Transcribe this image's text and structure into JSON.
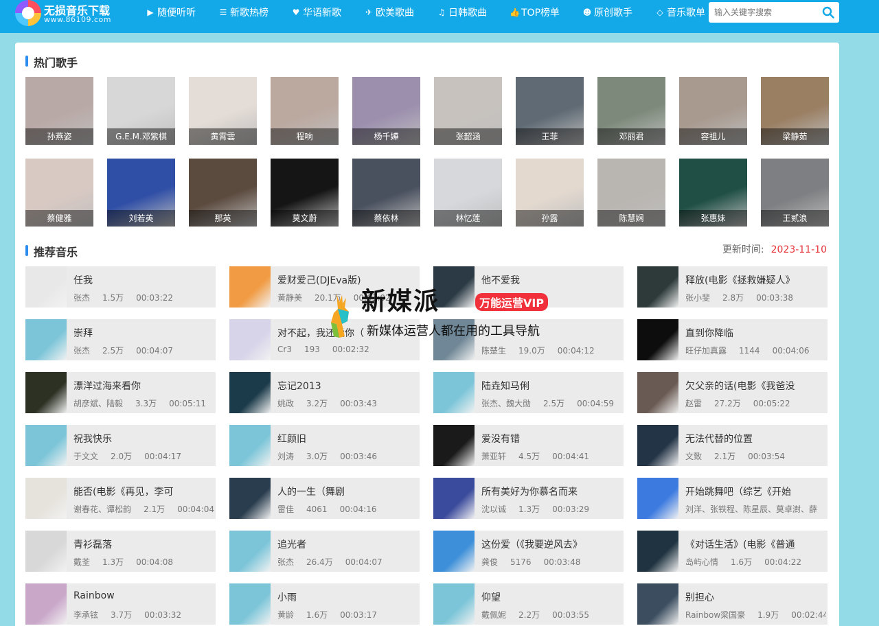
{
  "header": {
    "logo_title": "无损音乐下载",
    "logo_url": "www.86109.com",
    "nav": [
      {
        "icon": "play-circle-icon",
        "label": "随便听听"
      },
      {
        "icon": "list-icon",
        "label": "新歌热榜"
      },
      {
        "icon": "heart-icon",
        "label": "华语新歌"
      },
      {
        "icon": "plane-icon",
        "label": "欧美歌曲"
      },
      {
        "icon": "music-note-icon",
        "label": "日韩歌曲"
      },
      {
        "icon": "thumbs-up-icon",
        "label": "TOP榜单"
      },
      {
        "icon": "user-circle-icon",
        "label": "原创歌手"
      },
      {
        "icon": "diamond-icon",
        "label": "音乐歌单"
      }
    ],
    "search_placeholder": "输入关键字搜索"
  },
  "hot_singers": {
    "title": "热门歌手",
    "singers": [
      {
        "name": "孙燕姿",
        "color": "#b9a9a6"
      },
      {
        "name": "G.E.M.邓紫棋",
        "color": "#d7d7d7"
      },
      {
        "name": "黄霄雲",
        "color": "#e4dcd6"
      },
      {
        "name": "程响",
        "color": "#bba9a0"
      },
      {
        "name": "杨千嬅",
        "color": "#9c8fae"
      },
      {
        "name": "张韶涵",
        "color": "#c7c2bd"
      },
      {
        "name": "王菲",
        "color": "#5f6a74"
      },
      {
        "name": "邓丽君",
        "color": "#7d8a7b"
      },
      {
        "name": "容祖儿",
        "color": "#a89a8f"
      },
      {
        "name": "梁静茹",
        "color": "#9a7f63"
      },
      {
        "name": "蔡健雅",
        "color": "#d9c9c3"
      },
      {
        "name": "刘若英",
        "color": "#2f4ea6"
      },
      {
        "name": "那英",
        "color": "#5b4a3e"
      },
      {
        "name": "莫文蔚",
        "color": "#151515"
      },
      {
        "name": "蔡依林",
        "color": "#49505e"
      },
      {
        "name": "林忆莲",
        "color": "#d6d8dc"
      },
      {
        "name": "孙露",
        "color": "#e3d9cf"
      },
      {
        "name": "陈慧娴",
        "color": "#b9b5b0"
      },
      {
        "name": "张惠妹",
        "color": "#1f4f45"
      },
      {
        "name": "王贰浪",
        "color": "#7e7f82"
      }
    ]
  },
  "recommended": {
    "title": "推荐音乐",
    "update_label": "更新时间:",
    "update_date": "2023-11-10",
    "songs": [
      {
        "title": "任我",
        "artist": "张杰",
        "plays": "1.5万",
        "duration": "00:03:22",
        "cover": "#e8e8e8"
      },
      {
        "title": "爱财爱己(DJEva版)",
        "artist": "黄静美",
        "plays": "20.1万",
        "duration": "00:03:02",
        "cover": "#f19c45"
      },
      {
        "title": "他不爱我",
        "artist": "",
        "plays": "",
        "duration": "",
        "cover": "#2b3a44"
      },
      {
        "title": "释放(电影《拯救嫌疑人》",
        "artist": "张小斐",
        "plays": "2.8万",
        "duration": "00:03:38",
        "cover": "#2e3a3a"
      },
      {
        "title": "崇拜",
        "artist": "张杰",
        "plays": "2.5万",
        "duration": "00:04:07",
        "cover": "#7cc5d8"
      },
      {
        "title": "对不起，我还爱你（",
        "artist": "Cr3",
        "plays": "193",
        "duration": "00:02:32",
        "cover": "#d7d3e9"
      },
      {
        "title": "",
        "artist": "陈楚生",
        "plays": "19.0万",
        "duration": "00:04:12",
        "cover": "#6f8796"
      },
      {
        "title": "直到你降临",
        "artist": "旺仔加真露",
        "plays": "1144",
        "duration": "00:04:06",
        "cover": "#0d0d0d"
      },
      {
        "title": "漂洋过海来看你",
        "artist": "胡彦斌、陆毅",
        "plays": "3.3万",
        "duration": "00:05:11",
        "cover": "#2c3124"
      },
      {
        "title": "忘记2013",
        "artist": "姚政",
        "plays": "3.2万",
        "duration": "00:03:43",
        "cover": "#1c3b4a"
      },
      {
        "title": "陆垚知马俐",
        "artist": "张杰、魏大勋",
        "plays": "2.5万",
        "duration": "00:04:59",
        "cover": "#7cc5d8"
      },
      {
        "title": "欠父亲的话(电影《我爸没",
        "artist": "赵雷",
        "plays": "27.2万",
        "duration": "00:05:22",
        "cover": "#6a5a54"
      },
      {
        "title": "祝我快乐",
        "artist": "于文文",
        "plays": "2.0万",
        "duration": "00:04:17",
        "cover": "#7cc5d8"
      },
      {
        "title": "红颜旧",
        "artist": "刘涛",
        "plays": "3.0万",
        "duration": "00:03:46",
        "cover": "#7cc5d8"
      },
      {
        "title": "爱没有错",
        "artist": "萧亚轩",
        "plays": "4.5万",
        "duration": "00:04:41",
        "cover": "#1a1a1a"
      },
      {
        "title": "无法代替的位置",
        "artist": "文致",
        "plays": "2.1万",
        "duration": "00:03:54",
        "cover": "#243447"
      },
      {
        "title": "能否(电影《再见，李可",
        "artist": "谢春花、谭松韵",
        "plays": "2.1万",
        "duration": "00:04:04",
        "cover": "#e6e2dc"
      },
      {
        "title": "人的一生（舞剧",
        "artist": "雷佳",
        "plays": "4061",
        "duration": "00:04:16",
        "cover": "#2a3d4f"
      },
      {
        "title": "所有美好为你慕名而来",
        "artist": "沈以诚",
        "plays": "1.3万",
        "duration": "00:03:29",
        "cover": "#3a4a9c"
      },
      {
        "title": "开始跳舞吧（综艺《开始",
        "artist": "刘洋、张铁程、陈星辰、莫卓澍、薛",
        "plays": "",
        "duration": "",
        "cover": "#3d7ae0"
      },
      {
        "title": "青衫磊落",
        "artist": "戴荃",
        "plays": "1.3万",
        "duration": "00:04:08",
        "cover": "#d8d8d8"
      },
      {
        "title": "追光者",
        "artist": "张杰",
        "plays": "26.4万",
        "duration": "00:04:07",
        "cover": "#7cc5d8"
      },
      {
        "title": "这份爱（《我要逆风去》",
        "artist": "龚俊",
        "plays": "5176",
        "duration": "00:03:48",
        "cover": "#3c8fd8"
      },
      {
        "title": "《对话生活》(电影《普通",
        "artist": "岛屿心情",
        "plays": "1.6万",
        "duration": "00:04:22",
        "cover": "#1f3340"
      },
      {
        "title": "Rainbow",
        "artist": "李承铉",
        "plays": "3.7万",
        "duration": "00:03:32",
        "cover": "#c9a7c9"
      },
      {
        "title": "小雨",
        "artist": "黄龄",
        "plays": "1.6万",
        "duration": "00:03:17",
        "cover": "#7cc5d8"
      },
      {
        "title": "仰望",
        "artist": "戴佩妮",
        "plays": "2.2万",
        "duration": "00:03:55",
        "cover": "#7cc5d8"
      },
      {
        "title": "别担心",
        "artist": "Rainbow梁国豪",
        "plays": "1.9万",
        "duration": "00:02:44",
        "cover": "#3b4d5f"
      }
    ]
  },
  "watermark": {
    "title": "新媒派",
    "badge": "万能运营VIP",
    "subtitle": "新媒体运营人都在用的工具导航"
  }
}
